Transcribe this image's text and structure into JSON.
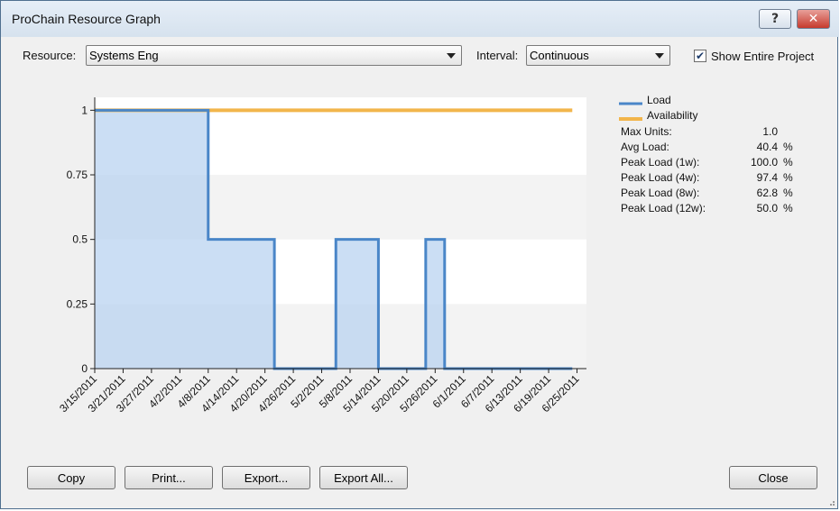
{
  "window": {
    "title": "ProChain Resource Graph"
  },
  "toolbar": {
    "resource_label": "Resource:",
    "resource_value": "Systems Eng",
    "interval_label": "Interval:",
    "interval_value": "Continuous",
    "show_entire_label": "Show Entire Project",
    "show_entire_checked": true
  },
  "legend": {
    "load": "Load",
    "availability": "Availability",
    "load_color": "#4a86c8",
    "availability_color": "#f2b54b"
  },
  "stats": [
    {
      "label": "Max Units:",
      "value": "1.0",
      "unit": ""
    },
    {
      "label": "Avg Load:",
      "value": "40.4",
      "unit": "%"
    },
    {
      "label": "Peak Load (1w):",
      "value": "100.0",
      "unit": "%"
    },
    {
      "label": "Peak Load (4w):",
      "value": "97.4",
      "unit": "%"
    },
    {
      "label": "Peak Load (8w):",
      "value": "62.8",
      "unit": "%"
    },
    {
      "label": "Peak Load (12w):",
      "value": "50.0",
      "unit": "%"
    }
  ],
  "buttons": {
    "copy": "Copy",
    "print": "Print...",
    "export": "Export...",
    "export_all": "Export All...",
    "close": "Close"
  },
  "chart_data": {
    "type": "area",
    "x_tick_labels": [
      "3/15/2011",
      "3/21/2011",
      "3/27/2011",
      "4/2/2011",
      "4/8/2011",
      "4/14/2011",
      "4/20/2011",
      "4/26/2011",
      "5/2/2011",
      "5/8/2011",
      "5/14/2011",
      "5/20/2011",
      "5/26/2011",
      "6/1/2011",
      "6/7/2011",
      "6/13/2011",
      "6/19/2011",
      "6/25/2011"
    ],
    "y_ticks": [
      0,
      0.25,
      0.5,
      0.75,
      1
    ],
    "y_tick_labels": [
      "0",
      "0.25",
      "0.5",
      "0.75",
      "1"
    ],
    "ylim": [
      0,
      1.05
    ],
    "xlim": [
      "3/15/2011",
      "6/27/2011"
    ],
    "series": [
      {
        "name": "Load",
        "step": true,
        "points": [
          [
            "3/15/2011",
            1
          ],
          [
            "4/8/2011",
            0.5
          ],
          [
            "4/22/2011",
            0
          ],
          [
            "5/5/2011",
            0.5
          ],
          [
            "5/14/2011",
            0
          ],
          [
            "5/24/2011",
            0.5
          ],
          [
            "5/28/2011",
            0
          ],
          [
            "6/24/2011",
            0
          ]
        ]
      },
      {
        "name": "Availability",
        "step": true,
        "points": [
          [
            "3/15/2011",
            1
          ],
          [
            "6/24/2011",
            1
          ]
        ]
      }
    ]
  }
}
